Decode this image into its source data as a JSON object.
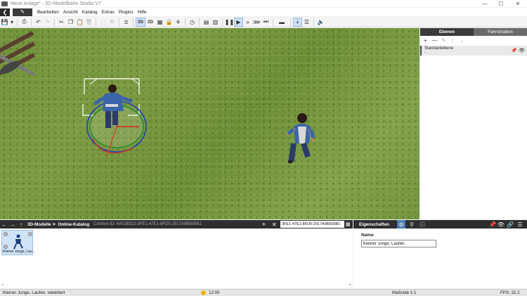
{
  "window": {
    "title": "Neue Anlage* - 3D-Modellbahn Studio V7",
    "controls": [
      "—",
      "☐",
      "✕"
    ]
  },
  "menubar": {
    "back_icon": "back-arrow-icon",
    "edit_icon": "pencil-icon",
    "items": [
      "Bearbeiten",
      "Ansicht",
      "Katalog",
      "Extras",
      "Plugins",
      "Hilfe"
    ]
  },
  "toolbar": {
    "view_3d": "3D",
    "view_2d": "2D",
    "icons": [
      "save-icon",
      "print-icon",
      "undo-icon",
      "redo-icon",
      "cut-icon",
      "copy-icon",
      "paste-icon",
      "delete-icon",
      "select-icon",
      "group-icon",
      "list-icon",
      "grid-icon",
      "lock-icon",
      "crosshair-icon",
      "clock-icon",
      "panel-left-icon",
      "panel-right-icon",
      "pause-icon",
      "play-icon",
      "fast-forward-icon",
      "skip-icon",
      "step-icon",
      "track-icon",
      "height-icon",
      "layers-icon",
      "sound-icon"
    ]
  },
  "layers_panel": {
    "tabs": [
      "Ebenen",
      "Fahrstraßen"
    ],
    "active_tab": "Ebenen",
    "tools": [
      "+",
      "—",
      "✎",
      "↑",
      "↓"
    ],
    "rows": [
      {
        "name": "Standardebene",
        "sub": "-"
      }
    ]
  },
  "catalog": {
    "breadcrumb": [
      "3D-Modelle",
      "Online-Katalog"
    ],
    "content_id": "Content-ID: 4A01B322-3FE1-47E1-8FD5-2917A9B509B1",
    "search_value": "3FE1-47E1-8FD5-2917A9B509B1",
    "items": [
      {
        "caption": "Kleiner Junge, Lau..."
      }
    ]
  },
  "properties": {
    "title": "Eigenschaften",
    "name_label": "Name",
    "name_value": "Kleiner Junge, Laufen."
  },
  "statusbar": {
    "selection": "Kleiner Junge, Laufen. selektiert",
    "time": "12:00",
    "scale": "Maßstab 1:1",
    "fps": "FPS: 32.2"
  },
  "colors": {
    "accent": "#4a7fb8",
    "dark_panel": "#2e2e2e",
    "grass": "#7c9a45"
  }
}
